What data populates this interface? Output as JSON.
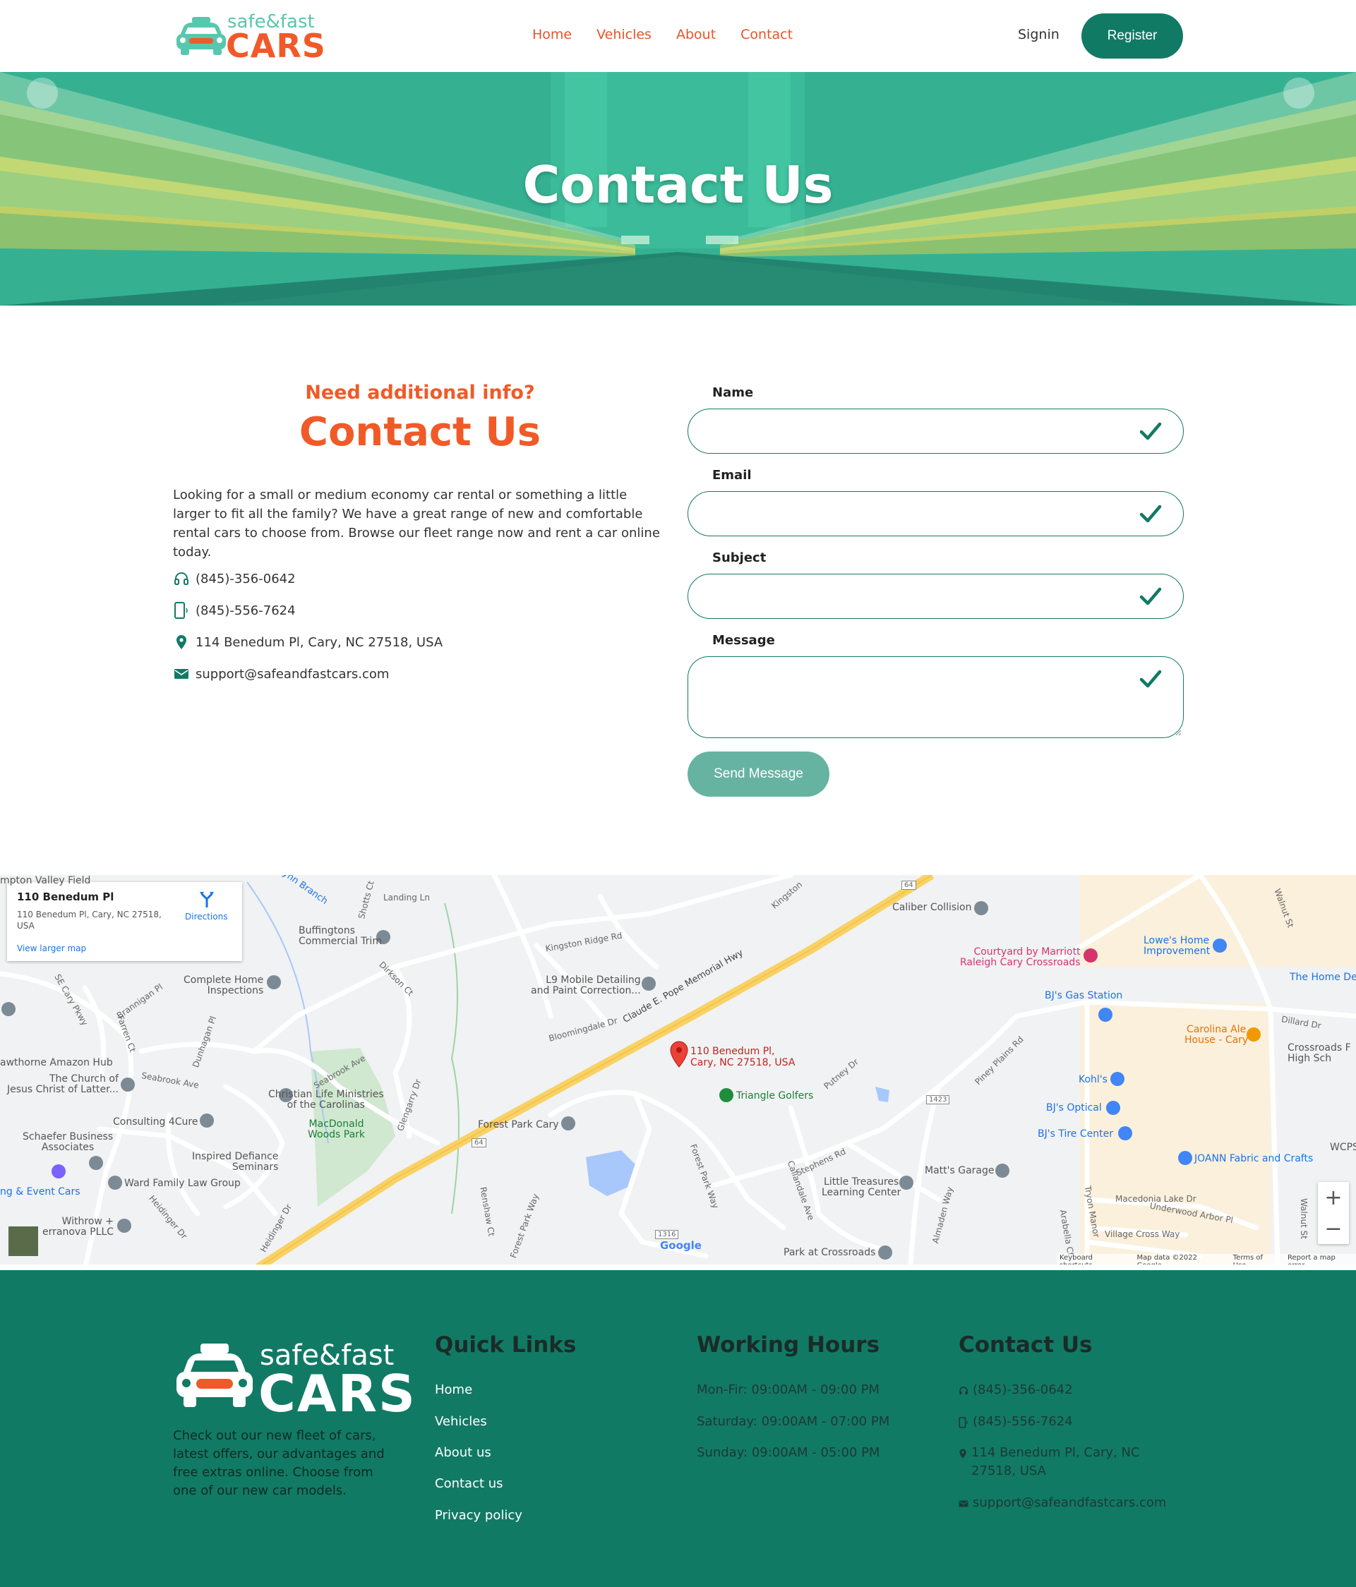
{
  "brand": {
    "logo_small": "safe&fast",
    "logo_big": "CARS",
    "orange": "#f05a28",
    "teal": "#117a65",
    "mint": "#57c7ad"
  },
  "nav": {
    "items": [
      "Home",
      "Vehicles",
      "About",
      "Contact"
    ],
    "signin": "Signin",
    "register": "Register"
  },
  "hero": {
    "title": "Contact Us"
  },
  "contact": {
    "eyebrow": "Need additional info?",
    "title": "Contact Us",
    "description": "Looking for a small or medium economy car rental or something a little larger to fit all the family? We have a great range of new and comfortable rental cars to choose from. Browse our fleet range now and rent a car online today.",
    "phone": "(845)-356-0642",
    "mobile": "(845)-556-7624",
    "address": "114 Benedum Pl, Cary, NC 27518, USA",
    "email": "support@safeandfastcars.com",
    "icons": [
      "headset-icon",
      "mobile-phone-icon",
      "location-pin-icon",
      "mail-icon"
    ]
  },
  "form": {
    "name_label": "Name",
    "email_label": "Email",
    "subject_label": "Subject",
    "message_label": "Message",
    "name_value": "",
    "email_value": "",
    "subject_value": "",
    "message_value": "",
    "send_label": "Send Message"
  },
  "map": {
    "card_title": "110 Benedum Pl",
    "card_address": "110 Benedum Pl, Cary, NC 27518, USA",
    "card_link": "View larger map",
    "card_directions": "Directions",
    "marker_label_1": "110 Benedum Pl,",
    "marker_label_2": "Cary, NC 27518, USA",
    "places": {
      "buffingtons": "Buffingtons",
      "commercial_trim": "Commercial Trim",
      "complete_home": "Complete Home",
      "inspections": "Inspections",
      "l9_detailing": "L9 Mobile Detailing",
      "paint_correction": "and Paint Correction...",
      "caliber": "Caliber Collision",
      "courtyard_1": "Courtyard by Marriott",
      "courtyard_2": "Raleigh Cary Crossroads",
      "lowes_1": "Lowe's Home",
      "lowes_2": "Improvement",
      "the_home_de": "The Home De",
      "bjs_gas": "BJ's Gas Station",
      "carolina_ale_1": "Carolina Ale",
      "carolina_ale_2": "House - Cary",
      "crossroads_1": "Crossroads F",
      "crossroads_2": "High Sch",
      "kohls": "Kohl's",
      "bjs_optical": "BJ's Optical",
      "bjs_tire": "BJ's Tire Center",
      "joann": "JOANN Fabric and Crafts",
      "wcps": "WCPS",
      "hawthorne": "awthorne Amazon Hub",
      "church_1": "The Church of",
      "church_2": "Jesus Christ of Latter...",
      "christian_1": "Christian Life Ministries",
      "christian_2": "of the Carolinas",
      "macdonald_1": "MacDonald",
      "macdonald_2": "Woods Park",
      "triangle": "Triangle Golfers",
      "forest_park": "Forest Park Cary",
      "consulting": "Consulting 4Cure",
      "schaefer_1": "Schaefer Business",
      "schaefer_2": "Associates",
      "inspired_1": "Inspired Defiance",
      "inspired_2": "Seminars",
      "ward": "Ward Family Law Group",
      "event_cars": "ng & Event Cars",
      "withrow_1": "Withrow +",
      "withrow_2": "erranova PLLC",
      "matts": "Matt's Garage",
      "little_1": "Little Treasures",
      "little_2": "Learning Center",
      "park": "Park at Crossroads",
      "valley": "mpton Valley Field"
    },
    "roads": {
      "pope": "Claude E. Pope Memorial Hwy",
      "kingston_ridge": "Kingston Ridge Rd",
      "bloomingdale": "Bloomingdale Dr",
      "seabrook_ave": "Seabrook Ave",
      "piney_plains": "Piney Plains Rd",
      "stephens": "Stephens Rd",
      "dillard": "Dillard Dr",
      "macedonia": "Macedonia Lake Dr",
      "underwood": "Underwood Arbor Pl",
      "village_cross": "Village Cross Way",
      "walnut": "Walnut St",
      "landing": "Landing Ln",
      "shotts": "Shotts Ct",
      "dirkson": "Dirkson Ct",
      "se_cary": "SE Cary Pkwy",
      "brannigan": "Brannigan Pl",
      "farren": "Farren Ct",
      "dunhagan": "Dunhagan Pl",
      "glengarry": "Glengarry Dr",
      "heidinger": "Heidinger Dr",
      "renshaw": "Renshaw Ct",
      "forest_park_way": "Forest Park Way",
      "callandale": "Callandale Ave",
      "almaden": "Almaden Way",
      "putney": "Putney Dr",
      "tryon": "Tryon Manor",
      "arabella": "Arabella Ct",
      "kingston": "Kingston",
      "branch": "ynn Branch",
      "r1423": "1423",
      "r1316": "1316",
      "r64": "64"
    },
    "attribution": [
      "Keyboard shortcuts",
      "Map data ©2022 Google",
      "Terms of Use",
      "Report a map error"
    ],
    "google": "Google",
    "zoom_in": "+",
    "zoom_out": "−"
  },
  "footer": {
    "description": "Check out our new fleet of cars, latest offers, our advantages and free extras online. Choose from one of our new car models.",
    "quick_links_title": "Quick Links",
    "quick_links": [
      "Home",
      "Vehicles",
      "About us",
      "Contact us",
      "Privacy policy"
    ],
    "hours_title": "Working Hours",
    "hours": [
      "Mon-Fir: 09:00AM - 09:00 PM",
      "Saturday: 09:00AM - 07:00 PM",
      "Sunday: 09:00AM - 05:00 PM"
    ],
    "contact_title": "Contact Us",
    "phone": "(845)-356-0642",
    "mobile": "(845)-556-7624",
    "address": "114 Benedum Pl, Cary, NC 27518, USA",
    "email": "support@safeandfastcars.com"
  }
}
